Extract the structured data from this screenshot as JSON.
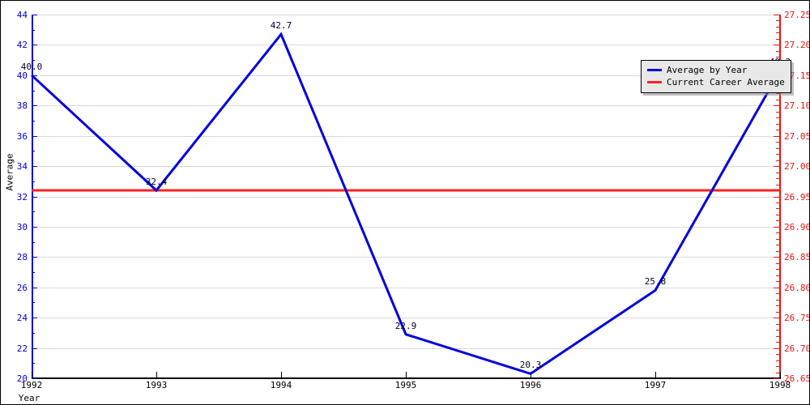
{
  "chart_data": {
    "type": "line",
    "title": "",
    "xlabel": "Year",
    "ylabel": "Average",
    "categories": [
      "1992",
      "1993",
      "1994",
      "1995",
      "1996",
      "1997",
      "1998"
    ],
    "x": [
      1992,
      1993,
      1994,
      1995,
      1996,
      1997,
      1998
    ],
    "xlim": [
      1992,
      1998
    ],
    "ylim": [
      20,
      44
    ],
    "y_ticks": [
      "20",
      "22",
      "24",
      "26",
      "28",
      "30",
      "32",
      "34",
      "36",
      "38",
      "40",
      "42",
      "44"
    ],
    "y2lim": [
      26.65,
      27.25
    ],
    "y2_ticks": [
      "26.65",
      "26.70",
      "26.75",
      "26.80",
      "26.85",
      "26.90",
      "26.95",
      "27.00",
      "27.05",
      "27.10",
      "27.15",
      "27.20",
      "27.25"
    ],
    "grid": true,
    "legend_position": "upper right",
    "series": [
      {
        "name": "Average by Year",
        "color": "#0000dd",
        "axis": "left",
        "values": [
          40.0,
          32.4,
          42.7,
          22.9,
          20.3,
          25.8,
          40.3
        ],
        "point_labels": [
          "40.0",
          "32.4",
          "42.7",
          "22.9",
          "20.3",
          "25.8",
          "40.3"
        ]
      },
      {
        "name": "Current Career Average",
        "color": "#ff2222",
        "axis": "left",
        "type": "hline",
        "value": 32.4,
        "value_right_axis": 26.96
      }
    ]
  },
  "axes": {
    "left": {
      "label": "Average",
      "color": "#0000cc",
      "ticks": [
        "44",
        "42",
        "40",
        "38",
        "36",
        "34",
        "32",
        "30",
        "28",
        "26",
        "24",
        "22",
        "20"
      ]
    },
    "right": {
      "color": "#ee1111",
      "ticks": [
        "27.25",
        "27.20",
        "27.15",
        "27.10",
        "27.05",
        "27.00",
        "26.95",
        "26.90",
        "26.85",
        "26.80",
        "26.75",
        "26.70",
        "26.65"
      ]
    },
    "bottom": {
      "label": "Year",
      "color": "#000000",
      "ticks": [
        "1992",
        "1993",
        "1994",
        "1995",
        "1996",
        "1997",
        "1998"
      ]
    }
  },
  "legend": {
    "items": [
      {
        "label": "Average by Year",
        "color": "#0000dd"
      },
      {
        "label": "Current Career Average",
        "color": "#ff2222"
      }
    ]
  },
  "colors": {
    "series_line": "#0000dd",
    "career_line": "#ff2222",
    "left_axis": "#0000cc",
    "right_axis": "#ee1111",
    "grid": "#d9d9d9",
    "background": "#ffffff",
    "legend_background": "#e8e8e8"
  }
}
